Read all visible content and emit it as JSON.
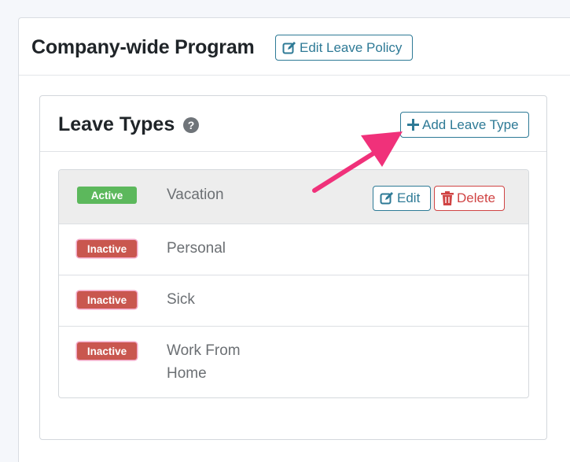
{
  "page": {
    "title": "Company-wide Program",
    "edit_policy_label": "Edit Leave Policy"
  },
  "leave_types": {
    "title": "Leave Types",
    "help_glyph": "?",
    "add_label": "Add Leave Type",
    "items": [
      {
        "status": "Active",
        "name": "Vacation",
        "status_color": "#5cb85c"
      },
      {
        "status": "Inactive",
        "name": "Personal",
        "status_color": "#c9574f"
      },
      {
        "status": "Inactive",
        "name": "Sick",
        "status_color": "#c9574f"
      },
      {
        "status": "Inactive",
        "name": "Work From Home",
        "status_color": "#c9574f"
      }
    ],
    "row_actions": {
      "edit_label": "Edit",
      "delete_label": "Delete"
    }
  },
  "colors": {
    "primary": "#2e7a96",
    "danger": "#d04444",
    "annotation_arrow": "#f0317a"
  },
  "icons": {
    "edit": "pencil-square-icon",
    "add": "plus-icon",
    "delete": "trash-icon",
    "help": "question-circle-icon"
  }
}
